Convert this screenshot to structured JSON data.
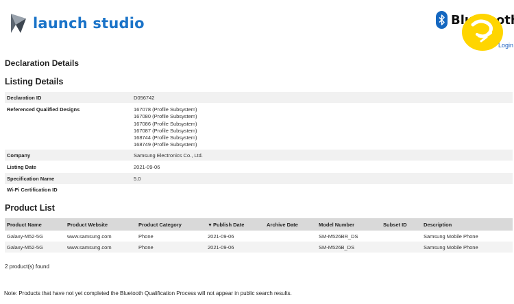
{
  "header": {
    "logo_icon": "launch-studio-flag-icon",
    "logo_text": "launch studio",
    "bluetooth_word": "Bluetooth",
    "trademark": "®",
    "login_label": "Login",
    "colors": {
      "brand_blue": "#1a73c8",
      "bluetooth_blue": "#1467c0",
      "sticker_yellow": "#ffd500"
    }
  },
  "page": {
    "title": "Declaration Details",
    "listing_heading": "Listing Details",
    "product_heading": "Product List"
  },
  "listing": {
    "declaration_id": {
      "label": "Declaration ID",
      "value": "D056742"
    },
    "referenced_designs": {
      "label": "Referenced Qualified Designs",
      "values": [
        "167078 (Profile Subsystem)",
        "167080 (Profile Subsystem)",
        "167086 (Profile Subsystem)",
        "167087 (Profile Subsystem)",
        "168744 (Profile Subsystem)",
        "168749 (Profile Subsystem)"
      ]
    },
    "company": {
      "label": "Company",
      "value": "Samsung Electronics Co., Ltd."
    },
    "listing_date": {
      "label": "Listing Date",
      "value": "2021-09-06"
    },
    "spec_name": {
      "label": "Specification Name",
      "value": "5.0"
    },
    "wifi_cert": {
      "label": "Wi-Fi Certification ID",
      "value": ""
    }
  },
  "products": {
    "columns": [
      "Product Name",
      "Product Website",
      "Product Category",
      "Publish Date",
      "Archive Date",
      "Model Number",
      "Subset ID",
      "Description"
    ],
    "sort_column": "Publish Date",
    "rows": [
      [
        "Galaxy-M52-5G",
        "www.samsung.com",
        "Phone",
        "2021-09-06",
        "",
        "SM-M526BR_DS",
        "",
        "Samsung Mobile Phone"
      ],
      [
        "Galaxy-M52-5G",
        "www.samsung.com",
        "Phone",
        "2021-09-06",
        "",
        "SM-M526B_DS",
        "",
        "Samsung Mobile Phone"
      ]
    ],
    "count_text": "2 product(s) found"
  },
  "footer": {
    "note": "Note: Products that have not yet completed the Bluetooth Qualification Process will not appear in public search results."
  }
}
